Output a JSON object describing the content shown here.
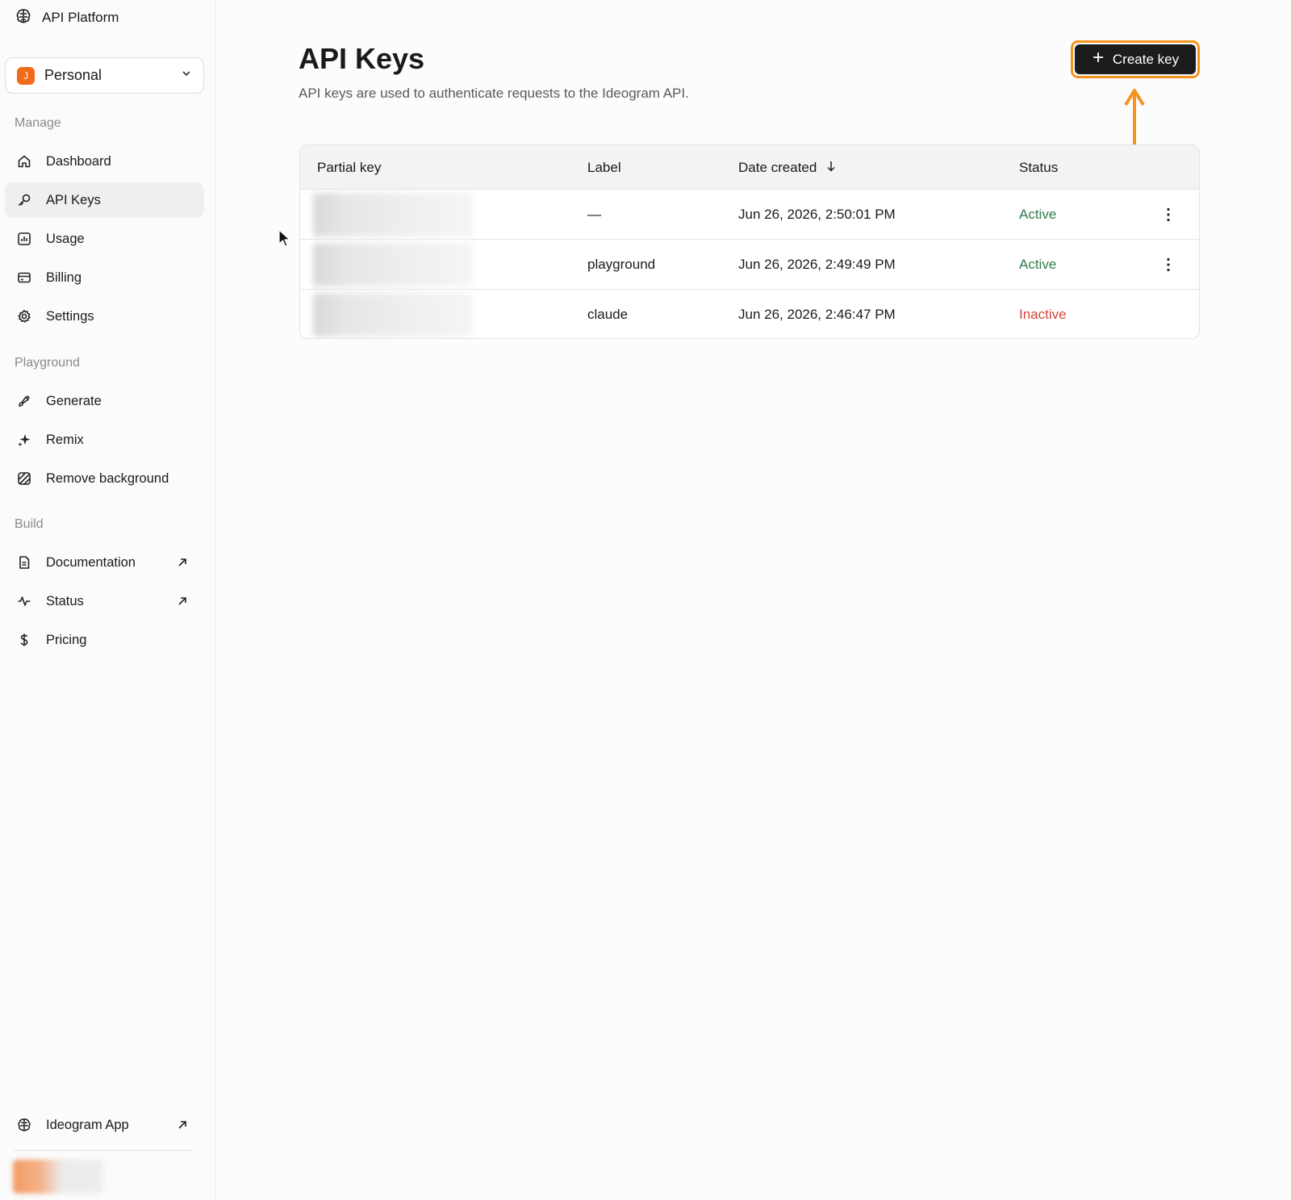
{
  "app": {
    "title": "API Platform"
  },
  "org": {
    "avatar_letter": "J",
    "name": "Personal"
  },
  "sidebar": {
    "sections": {
      "manage": "Manage",
      "playground": "Playground",
      "build": "Build"
    },
    "items": [
      {
        "label": "Dashboard",
        "icon": "home-icon",
        "active": false
      },
      {
        "label": "API Keys",
        "icon": "key-icon",
        "active": true
      },
      {
        "label": "Usage",
        "icon": "chart-icon",
        "active": false
      },
      {
        "label": "Billing",
        "icon": "card-icon",
        "active": false
      },
      {
        "label": "Settings",
        "icon": "gear-icon",
        "active": false
      },
      {
        "label": "Generate",
        "icon": "brush-icon",
        "active": false
      },
      {
        "label": "Remix",
        "icon": "sparkle-icon",
        "active": false
      },
      {
        "label": "Remove background",
        "icon": "hatch-icon",
        "active": false
      },
      {
        "label": "Documentation",
        "icon": "doc-icon",
        "external": true
      },
      {
        "label": "Status",
        "icon": "pulse-icon",
        "external": true
      },
      {
        "label": "Pricing",
        "icon": "dollar-icon",
        "external": false
      }
    ],
    "footer": {
      "label": "Ideogram App"
    }
  },
  "main": {
    "title": "API Keys",
    "subtitle": "API keys are used to authenticate requests to the Ideogram API.",
    "create_button": "Create key",
    "table": {
      "headers": [
        "Partial key",
        "Label",
        "Date created",
        "Status"
      ],
      "rows": [
        {
          "label": "—",
          "date": "Jun 26, 2026, 2:50:01 PM",
          "status": "Active"
        },
        {
          "label": "playground",
          "date": "Jun 26, 2026, 2:49:49 PM",
          "status": "Active"
        },
        {
          "label": "claude",
          "date": "Jun 26, 2026, 2:46:47 PM",
          "status": "Inactive"
        }
      ]
    }
  },
  "colors": {
    "accent_highlight": "#f7921e",
    "active_status": "#2f7a4e",
    "inactive_status": "#d6453b",
    "org_avatar": "#f26a1b"
  }
}
